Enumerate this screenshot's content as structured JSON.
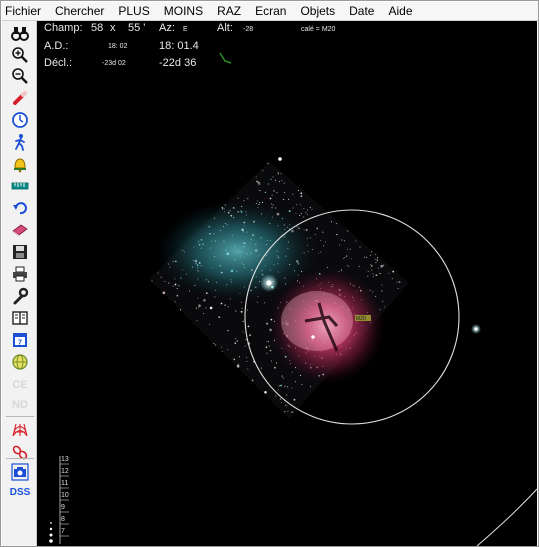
{
  "menu": [
    "Fichier",
    "Chercher",
    "PLUS",
    "MOINS",
    "RAZ",
    "Ecran",
    "Objets",
    "Date",
    "Aide"
  ],
  "hud": {
    "champ_label": "Champ:",
    "champ_deg": "58",
    "champ_x": "x",
    "champ_min": "55 '",
    "az_label": "Az:",
    "az_value": "E",
    "alt_label": "Alt:",
    "alt_value": "-28",
    "cale_text": "calé = M20",
    "ad_label": "A.D.:",
    "ad_small": "18: 02",
    "ad_value": "18: 01.4",
    "decl_label": "Décl.:",
    "decl_small": "-23d 02",
    "decl_value": "-22d 36"
  },
  "toolbar": {
    "icons": [
      "binoculars-icon",
      "zoom-in-icon",
      "zoom-out-icon",
      "pencil-icon",
      "clock-icon",
      "walking-man-icon",
      "bell-icon",
      "ruler-icon",
      "undo-icon",
      "book-icon",
      "save-icon",
      "print-icon",
      "wrench-icon",
      "library-icon",
      "calendar-icon",
      "globe-icon"
    ],
    "ce_label": "CE",
    "nd_label": "ND",
    "dss_label": "DSS"
  },
  "scale": [
    "13",
    "12",
    "11",
    "10",
    "9",
    "8",
    "7"
  ],
  "object_label": "M20",
  "colors": {
    "nebula_pink": "#d23a6e",
    "nebula_blue": "#2f9aa6",
    "sky_background": "#000000",
    "toolbar_accent": "#1a4fd6"
  }
}
